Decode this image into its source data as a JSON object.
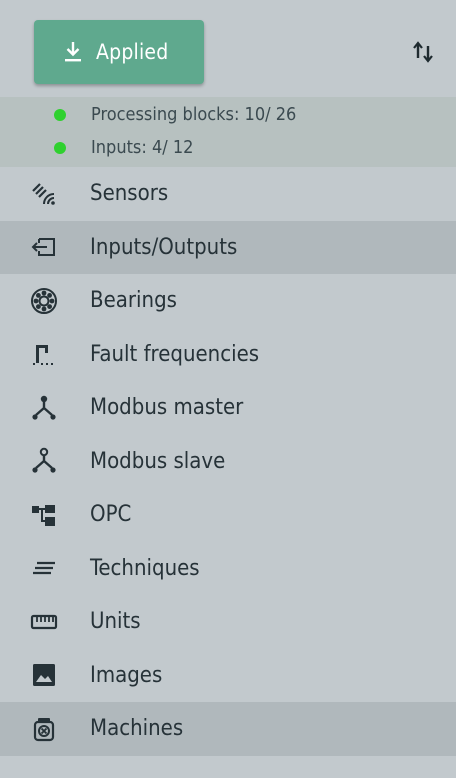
{
  "header": {
    "applied_label": "Applied"
  },
  "status": {
    "items": [
      {
        "label": "Processing blocks: 10/ 26",
        "color": "#2fd12f"
      },
      {
        "label": "Inputs: 4/ 12",
        "color": "#2fd12f"
      }
    ]
  },
  "nav": {
    "items": [
      {
        "label": "Sensors",
        "icon": "sensor-icon",
        "selected": false
      },
      {
        "label": "Inputs/Outputs",
        "icon": "input-output-icon",
        "selected": true
      },
      {
        "label": "Bearings",
        "icon": "bearing-icon",
        "selected": false
      },
      {
        "label": "Fault frequencies",
        "icon": "fault-frequency-icon",
        "selected": false
      },
      {
        "label": "Modbus master",
        "icon": "modbus-master-icon",
        "selected": false
      },
      {
        "label": "Modbus slave",
        "icon": "modbus-slave-icon",
        "selected": false
      },
      {
        "label": "OPC",
        "icon": "opc-icon",
        "selected": false
      },
      {
        "label": "Techniques",
        "icon": "techniques-icon",
        "selected": false
      },
      {
        "label": "Units",
        "icon": "ruler-icon",
        "selected": false
      },
      {
        "label": "Images",
        "icon": "image-icon",
        "selected": false
      },
      {
        "label": "Machines",
        "icon": "machine-icon",
        "selected": true
      }
    ]
  },
  "colors": {
    "accent": "#5fa98e",
    "background": "#c2c9cd",
    "status_background": "#b7c1c0",
    "selected_background": "#b0b8bc",
    "status_ok": "#2fd12f"
  }
}
